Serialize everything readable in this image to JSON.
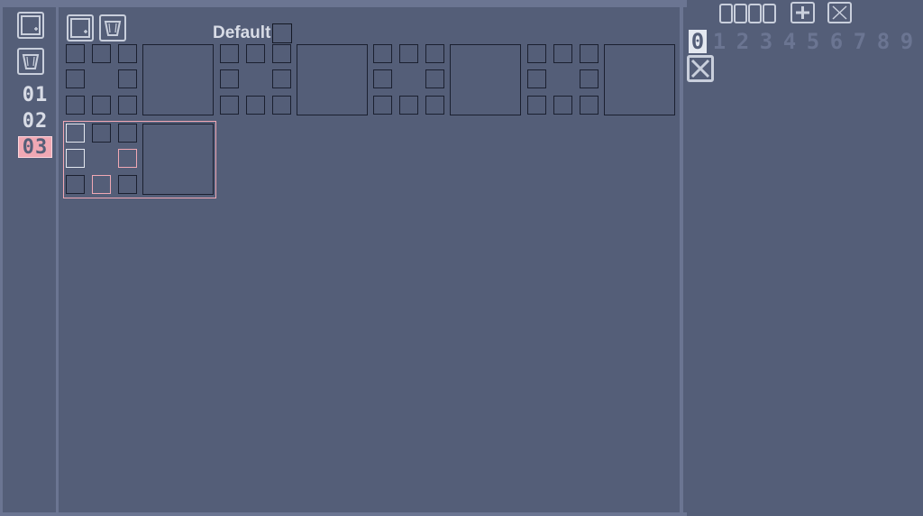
{
  "banks": {
    "items": [
      "01",
      "02",
      "03"
    ],
    "active_index": 2
  },
  "main": {
    "default_label": "Default"
  },
  "right": {
    "counter_digits": [
      "",
      "",
      "",
      ""
    ],
    "slots": [
      "0",
      "1",
      "2",
      "3",
      "4",
      "5",
      "6",
      "7",
      "8",
      "9"
    ],
    "active_slot": "0"
  },
  "icons": {
    "left_add": "add-square-icon",
    "left_delete": "trash-icon",
    "main_add": "add-square-icon",
    "main_delete": "trash-icon",
    "right_add": "plus-icon",
    "right_close": "close-icon",
    "right_clear": "clear-x-icon"
  },
  "colors": {
    "background": "#545e78",
    "border": "#6b7592",
    "text": "#d8dce6",
    "accent": "#f0a8b4",
    "tile_line": "#1b2030"
  }
}
